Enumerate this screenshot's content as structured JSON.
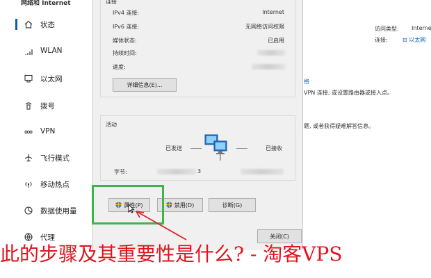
{
  "window": {
    "partial_title": "网络和 Internet"
  },
  "sidebar": {
    "items": [
      {
        "label": "状态",
        "icon": "home-icon",
        "active": true
      },
      {
        "label": "WLAN",
        "icon": "wifi-icon",
        "active": false
      },
      {
        "label": "以太网",
        "icon": "ethernet-icon",
        "active": false
      },
      {
        "label": "拨号",
        "icon": "dialup-icon",
        "active": false
      },
      {
        "label": "VPN",
        "icon": "vpn-icon",
        "active": false
      },
      {
        "label": "飞行模式",
        "icon": "airplane-icon",
        "active": false
      },
      {
        "label": "移动热点",
        "icon": "hotspot-icon",
        "active": false
      },
      {
        "label": "数据使用量",
        "icon": "data-usage-icon",
        "active": false
      },
      {
        "label": "代理",
        "icon": "globe-icon",
        "active": false
      }
    ]
  },
  "dialog": {
    "connection_section": "连接",
    "rows": [
      {
        "label": "IPv4 连接:",
        "value": "Internet"
      },
      {
        "label": "IPv6 连接:",
        "value": "无网络访问权限"
      },
      {
        "label": "媒体状态:",
        "value": "已启用"
      },
      {
        "label": "持续时间:",
        "value": ""
      },
      {
        "label": "速度:",
        "value": ""
      }
    ],
    "details_button": "详细信息(E)...",
    "activity_section": "活动",
    "sent_label": "已发送",
    "received_label": "已接收",
    "bytes_label": "字节:",
    "bytes_sent_partial": "3",
    "properties_button": "属性(P)",
    "disable_button": "禁用(D)",
    "diagnose_button": "诊断(G)",
    "close_button": "关闭(C)"
  },
  "right_panel": {
    "access_type_label": "访问类型:",
    "access_type_value": "Interne",
    "connection_label": "连接:",
    "connection_value": "以太网",
    "partial_heading": "络",
    "vpn_text": "VPN 连接; 或设置路由器或接入点。",
    "troubleshoot_text": "题, 或者获得疑难解答信息。"
  },
  "colors": {
    "accent": "#0a5fb4",
    "highlight": "#3db54a",
    "watermark": "#e0141e",
    "arrow": "#d9262c"
  },
  "watermark": {
    "text": "此的步骤及其重要性是什么? - 淘客VPS"
  }
}
